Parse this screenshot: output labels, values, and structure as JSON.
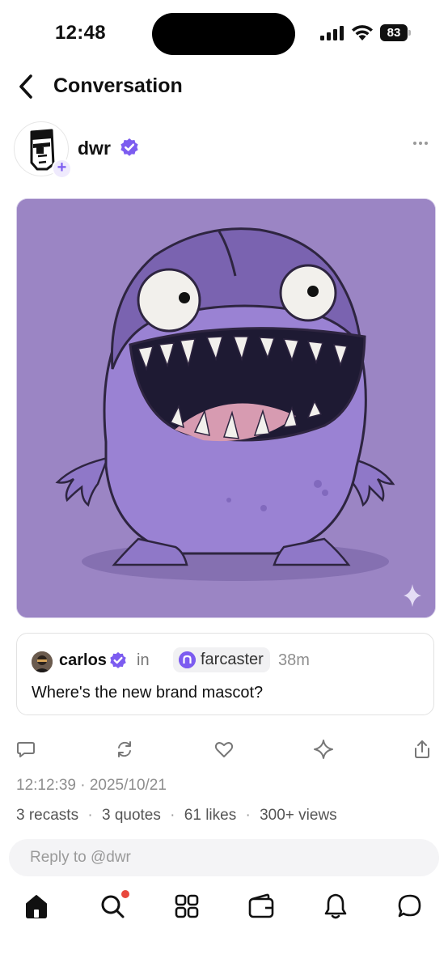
{
  "status_bar": {
    "time": "12:48",
    "battery": "83"
  },
  "header": {
    "title": "Conversation"
  },
  "post": {
    "author": {
      "name": "dwr"
    },
    "quote": {
      "author": "carlos",
      "in_label": "in",
      "channel": "farcaster",
      "age": "38m",
      "text": "Where's the new brand mascot?"
    },
    "timestamp": "12:12:39 · 2025/10/21",
    "stats": {
      "recasts": "3 recasts",
      "quotes": "3 quotes",
      "likes": "61 likes",
      "views": "300+ views",
      "separator": "·"
    }
  },
  "reply": {
    "placeholder": "Reply to @dwr"
  },
  "colors": {
    "accent": "#7c5cf0",
    "image_bg": "#9b85c4",
    "notification": "#e8473c"
  },
  "icons": {
    "actions": [
      "comment-icon",
      "recast-icon",
      "heart-icon",
      "sparkle-icon",
      "share-icon"
    ],
    "tabs": [
      "home-icon",
      "search-icon",
      "apps-icon",
      "wallet-icon",
      "bell-icon",
      "chat-icon"
    ]
  }
}
